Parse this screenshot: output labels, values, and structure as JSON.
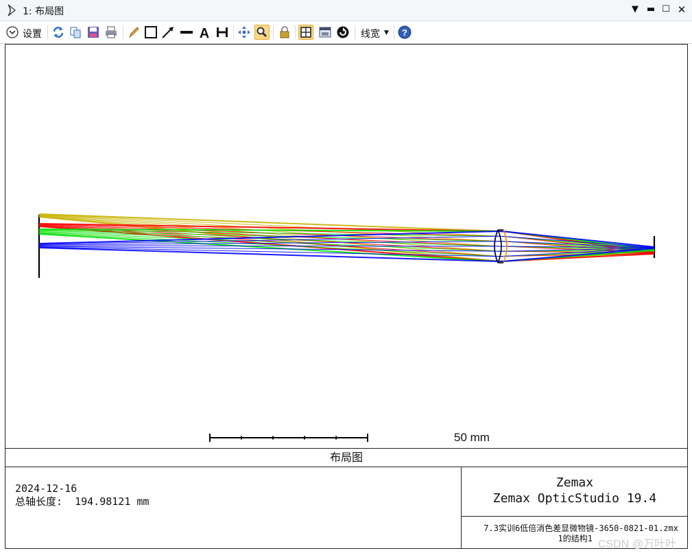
{
  "window": {
    "title": "1: 布局图"
  },
  "toolbar": {
    "settings_label": "设置",
    "linewidth_label": "线宽",
    "buttons": [
      "refresh-icon",
      "copy-icon",
      "save-icon",
      "print-icon",
      "pencil-icon",
      "rectangle-icon",
      "arrow-icon",
      "line-icon",
      "text-icon",
      "dimension-icon",
      "pan-icon",
      "zoom-icon",
      "lock-icon",
      "grid-layout-icon",
      "window-icon",
      "rotate-icon",
      "help-icon"
    ]
  },
  "plot": {
    "scale_bar_label": "50 mm",
    "caption": "布局图",
    "ray_colors": [
      "#c8b400",
      "#ff0000",
      "#00e000",
      "#0000ff"
    ],
    "lens_color": "#000080",
    "lens_edge_color": "#ff8000"
  },
  "info": {
    "date": "2024-12-16",
    "track_label": "总轴长度:",
    "track_value": "194.98121 mm",
    "brand": "Zemax",
    "product": "Zemax OpticStudio 19.4",
    "file": "7.3实训6低倍消色差显微物镜-3650-0821-01.zmx",
    "config": "1的结构1"
  },
  "watermark": "CSDN @万叶叶"
}
